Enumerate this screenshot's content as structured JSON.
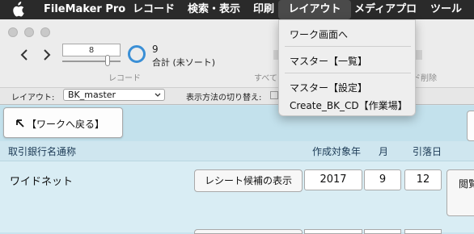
{
  "menubar": {
    "app": "FileMaker Pro",
    "items": [
      "レコード",
      "検索・表示",
      "印刷",
      "レイアウト",
      "メディアプロ",
      "ツール"
    ],
    "active_index": 3
  },
  "toolbar": {
    "record_number": "8",
    "found_count": "9",
    "total_label": "合計 (未ソート)",
    "record_label": "レコード",
    "show_all_label": "すべて",
    "delete_label": "ド削除"
  },
  "layoutbar": {
    "layout_label": "レイアウト:",
    "layout_value": "BK_master",
    "view_label": "表示方法の切り替え:"
  },
  "layout_menu": {
    "items": [
      "ワーク画面へ",
      "マスター【一覧】",
      "マスター【設定】",
      "Create_BK_CD【作業場】"
    ]
  },
  "content": {
    "back_button": "【ワークへ戻る】",
    "columns": {
      "bank": "取引銀行名通称",
      "year": "作成対象年",
      "month": "月",
      "day": "引落日"
    },
    "row": {
      "bank_name": "ワイドネット",
      "receipt_button": "レシート候補の表示",
      "year": "2017",
      "month": "9",
      "day": "12",
      "side_button": "閲覧"
    }
  },
  "colors": {
    "menubar_bg": "#2a2a2a",
    "progress_ring": "#3a8fd6",
    "content_bg": "#c9e3ee"
  }
}
